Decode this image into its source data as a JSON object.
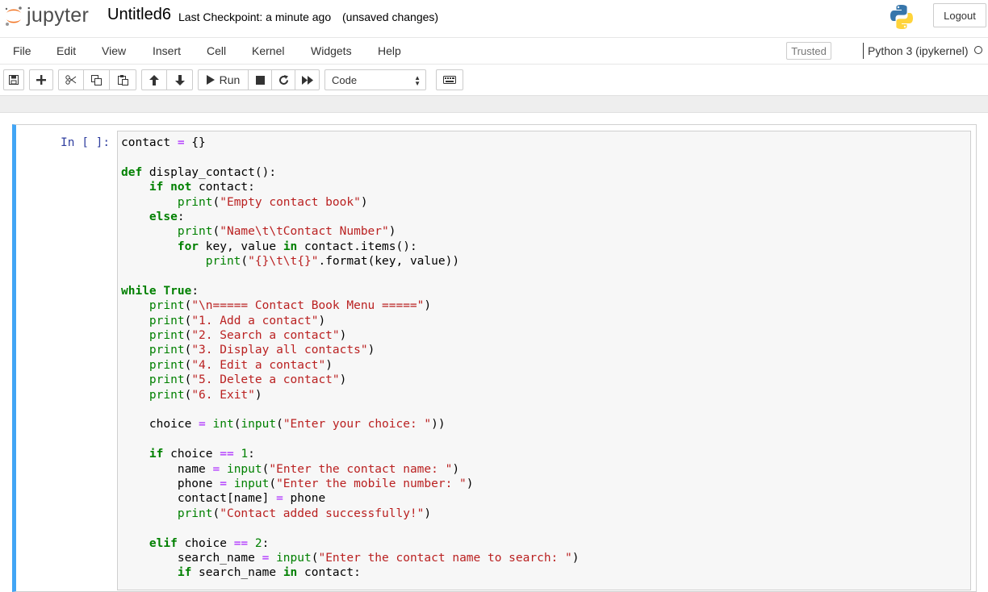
{
  "header": {
    "logo_text": "jupyter",
    "notebook_title": "Untitled6",
    "checkpoint": "Last Checkpoint: a minute ago",
    "unsaved": "(unsaved changes)",
    "logout_label": "Logout"
  },
  "menubar": {
    "items": [
      "File",
      "Edit",
      "View",
      "Insert",
      "Cell",
      "Kernel",
      "Widgets",
      "Help"
    ],
    "trusted_label": "Trusted",
    "kernel_name": "Python 3 (ipykernel)"
  },
  "toolbar": {
    "run_label": "Run",
    "cell_type": "Code",
    "icons": [
      "save-icon",
      "plus-icon",
      "cut-icon",
      "copy-icon",
      "paste-icon",
      "arrow-up-icon",
      "arrow-down-icon",
      "play-icon",
      "stop-icon",
      "restart-icon",
      "fast-forward-icon",
      "keyboard-icon"
    ]
  },
  "cell": {
    "prompt": "In [ ]:",
    "code_lines": [
      "contact = {}",
      "",
      "def display_contact():",
      "    if not contact:",
      "        print(\"Empty contact book\")",
      "    else:",
      "        print(\"Name\\t\\tContact Number\")",
      "        for key, value in contact.items():",
      "            print(\"{}\\t\\t{}\".format(key, value))",
      "",
      "while True:",
      "    print(\"\\n===== Contact Book Menu =====\")",
      "    print(\"1. Add a contact\")",
      "    print(\"2. Search a contact\")",
      "    print(\"3. Display all contacts\")",
      "    print(\"4. Edit a contact\")",
      "    print(\"5. Delete a contact\")",
      "    print(\"6. Exit\")",
      "",
      "    choice = int(input(\"Enter your choice: \"))",
      "",
      "    if choice == 1:",
      "        name = input(\"Enter the contact name: \")",
      "        phone = input(\"Enter the mobile number: \")",
      "        contact[name] = phone",
      "        print(\"Contact added successfully!\")",
      "",
      "    elif choice == 2:",
      "        search_name = input(\"Enter the contact name to search: \")",
      "        if search_name in contact:"
    ]
  },
  "colors": {
    "keyword": "#008000",
    "string": "#ba2121",
    "operator": "#aa22ff",
    "active_cell_border": "#42a5f5",
    "prompt": "#303f9f"
  }
}
